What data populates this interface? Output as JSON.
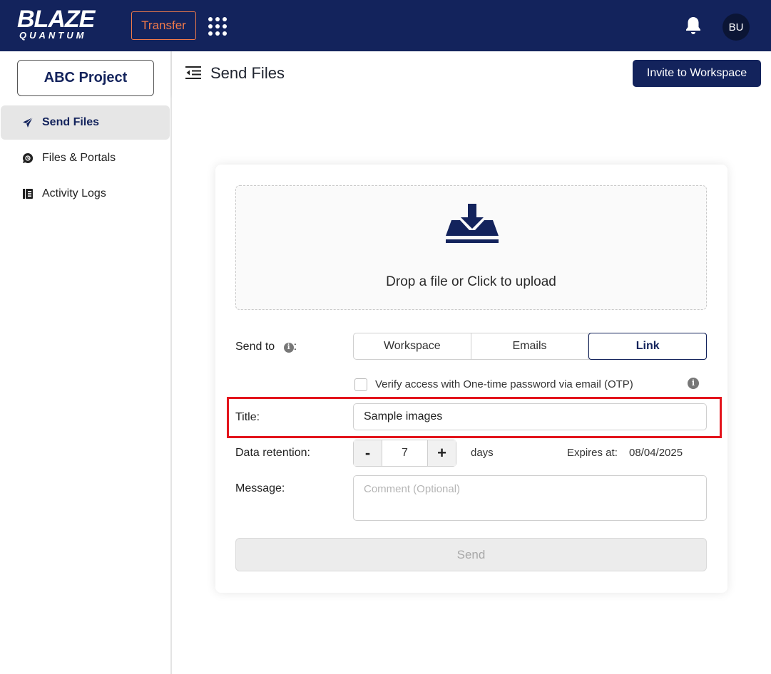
{
  "brand": {
    "logo_main": "BLAZE",
    "logo_sub": "QUANTUM"
  },
  "topbar": {
    "transfer_label": "Transfer",
    "apps_icon": "grid-icon",
    "bell_icon": "bell-icon",
    "avatar_initials": "BU"
  },
  "sidebar": {
    "project_label": "ABC Project",
    "items": [
      {
        "label": "Send Files",
        "icon": "paper-plane-icon",
        "active": true
      },
      {
        "label": "Files & Portals",
        "icon": "chat-bubble-icon",
        "active": false
      },
      {
        "label": "Activity Logs",
        "icon": "log-book-icon",
        "active": false
      }
    ]
  },
  "header": {
    "title": "Send Files",
    "invite_label": "Invite to Workspace"
  },
  "form": {
    "drop_text": "Drop a file or Click to upload",
    "send_to_label": "Send to",
    "send_to_suffix": ":",
    "send_to_options": [
      "Workspace",
      "Emails",
      "Link"
    ],
    "send_to_selected": "Link",
    "otp_label": "Verify access with One-time password via email (OTP)",
    "otp_checked": false,
    "title_label": "Title:",
    "title_value": "Sample images",
    "retention_label": "Data retention:",
    "retention_minus": "-",
    "retention_plus": "+",
    "retention_value": "7",
    "retention_unit": "days",
    "expires_label": "Expires at:",
    "expires_value": "08/04/2025",
    "message_label": "Message:",
    "message_placeholder": "Comment (Optional)",
    "send_label": "Send",
    "info_glyph": "i"
  },
  "colors": {
    "brand_navy": "#13235c",
    "transfer_orange": "#f07a4a",
    "highlight_red": "#e3141c"
  }
}
